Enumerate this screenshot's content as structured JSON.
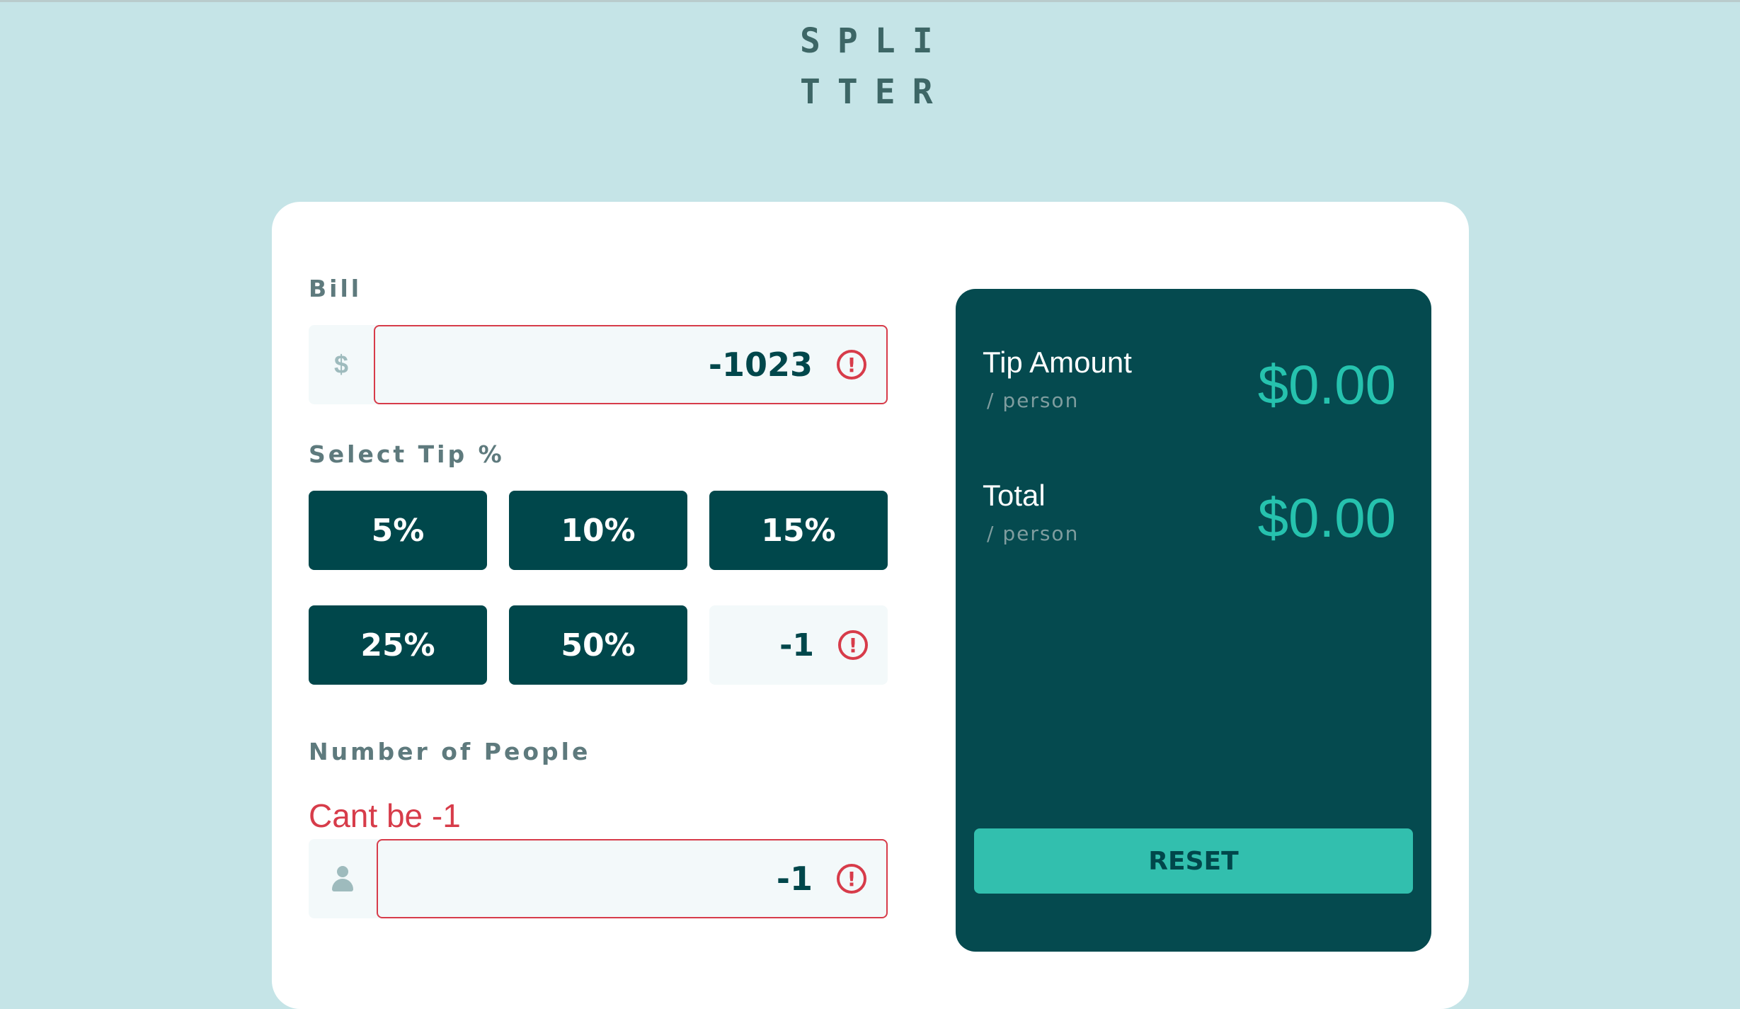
{
  "logo": {
    "line1": "SPLI",
    "line2": "TTER"
  },
  "bill": {
    "label": "Bill",
    "prefix": "$",
    "value": "-1023",
    "error_icon": "!"
  },
  "tip": {
    "label": "Select Tip %",
    "options": [
      "5%",
      "10%",
      "15%",
      "25%",
      "50%"
    ],
    "custom_value": "-1",
    "error_icon": "!"
  },
  "people": {
    "label": "Number of People",
    "error": "Cant be -1",
    "value": "-1",
    "icon": "person-icon",
    "error_icon": "!"
  },
  "results": {
    "tip_amount_label": "Tip Amount",
    "tip_amount_sub": "/ person",
    "tip_amount_value": "$0.00",
    "total_label": "Total",
    "total_sub": "/ person",
    "total_value": "$0.00",
    "reset_label": "RESET"
  },
  "colors": {
    "background": "#c5e4e7",
    "dark_cyan": "#00474b",
    "accent": "#26c2ae",
    "error": "#d73c4a"
  }
}
